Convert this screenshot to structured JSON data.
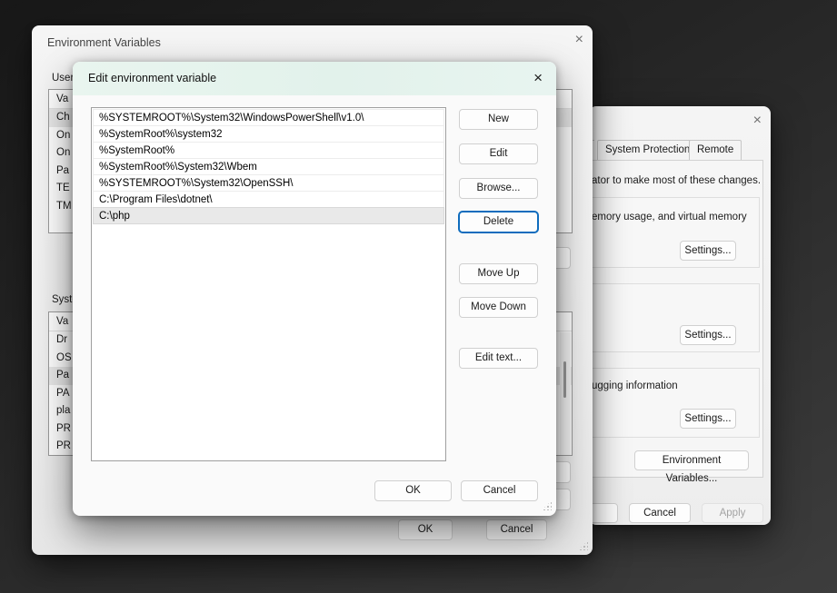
{
  "desktop": {
    "bg_top": "#181818",
    "bg_bottom": "#3d3d3d"
  },
  "env_window": {
    "title": "Environment Variables",
    "close_glyph": "×",
    "user_label_fragment": "User",
    "user_table": {
      "header_fragment": "Va",
      "rows": [
        "Ch",
        "On",
        "On",
        "Pa",
        "TE",
        "TM"
      ],
      "selected_row": 0
    },
    "system_label_fragment": "Syste",
    "system_table": {
      "header_fragment": "Va",
      "rows": [
        "Dr",
        "OS",
        "Pa",
        "PA",
        "pla",
        "PR",
        "PR"
      ],
      "selected_row": 2
    },
    "ok_label": "OK",
    "cancel_label": "Cancel"
  },
  "edit_dialog": {
    "title": "Edit environment variable",
    "close_glyph": "×",
    "titlebar_color": "#e6f4ee",
    "accent_color": "#0f6cbd",
    "selected_index": 6,
    "entries": [
      "%SYSTEMROOT%\\System32\\WindowsPowerShell\\v1.0\\",
      "%SystemRoot%\\system32",
      "%SystemRoot%",
      "%SystemRoot%\\System32\\Wbem",
      "%SYSTEMROOT%\\System32\\OpenSSH\\",
      "C:\\Program Files\\dotnet\\",
      "C:\\php"
    ],
    "buttons": {
      "new": "New",
      "edit": "Edit",
      "browse": "Browse...",
      "delete": "Delete",
      "move_up": "Move Up",
      "move_down": "Move Down",
      "edit_text": "Edit text...",
      "ok": "OK",
      "cancel": "Cancel"
    }
  },
  "system_properties": {
    "close_glyph": "×",
    "tabs": [
      "System Protection",
      "Remote"
    ],
    "admin_text_fragment": "ator to make most of these changes.",
    "performance_text_fragment": "emory usage, and virtual memory",
    "startup_text_fragment": "ugging information",
    "settings_label": "Settings...",
    "environment_variables_label": "Environment Variables...",
    "cancel_label": "Cancel",
    "apply_label": "Apply"
  }
}
